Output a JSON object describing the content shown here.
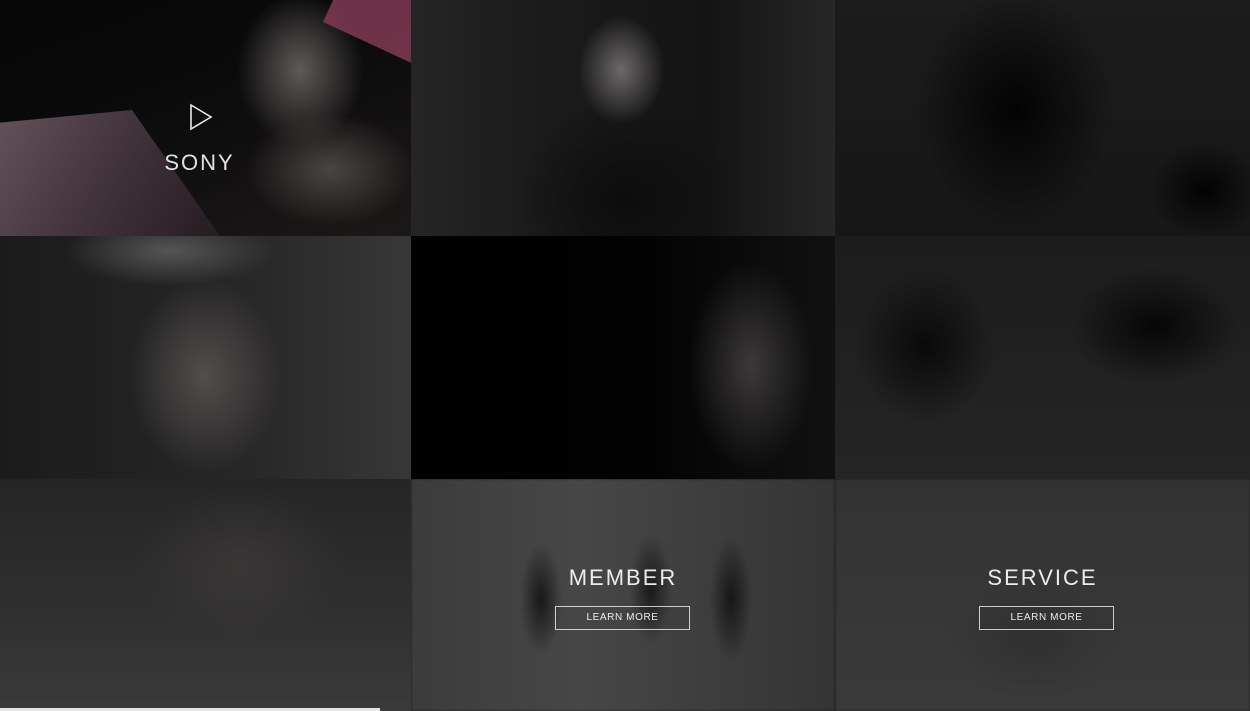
{
  "tiles": [
    {
      "id": "t1",
      "type": "brand-video",
      "brand": "SONY",
      "icon": "play-icon"
    },
    {
      "id": "t2",
      "type": "photo"
    },
    {
      "id": "t3",
      "type": "photo"
    },
    {
      "id": "t4",
      "type": "photo"
    },
    {
      "id": "t5",
      "type": "photo"
    },
    {
      "id": "t6",
      "type": "photo"
    },
    {
      "id": "t7",
      "type": "photo"
    },
    {
      "id": "t8",
      "type": "section"
    },
    {
      "id": "t9",
      "type": "section"
    }
  ],
  "brand": {
    "label": "SONY"
  },
  "member": {
    "heading": "MEMBER",
    "button": "LEARN MORE"
  },
  "service": {
    "heading": "SERVICE",
    "button": "LEARN MORE"
  },
  "colors": {
    "overlay_text": "#ffffff",
    "button_border": "#ffffff",
    "background": "#000000"
  }
}
